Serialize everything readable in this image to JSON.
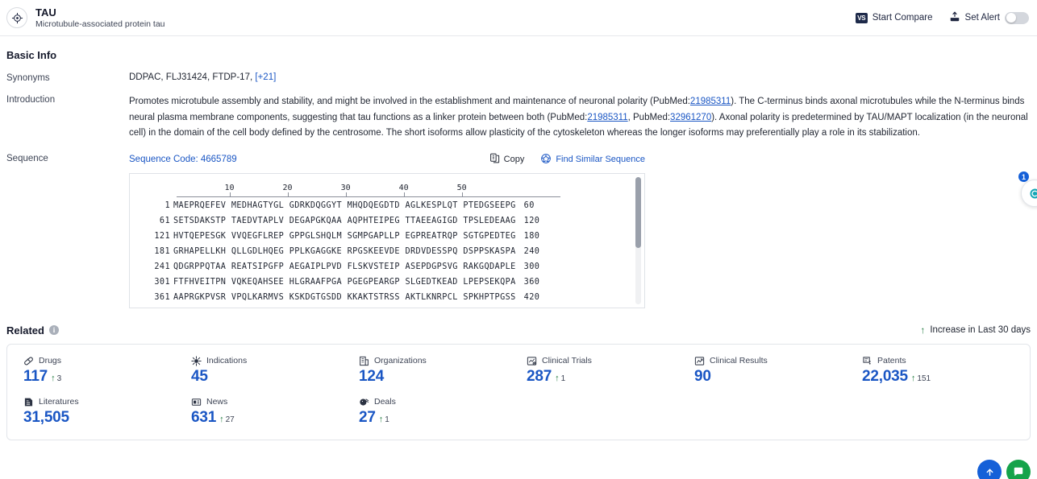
{
  "header": {
    "logo_icon": "target-crosshair-icon",
    "title": "TAU",
    "subtitle": "Microtubule-associated protein tau",
    "actions": {
      "start_compare": "Start Compare",
      "vs_badge": "VS",
      "set_alert": "Set Alert",
      "alert_toggle_state": "off"
    }
  },
  "basic_info": {
    "section_title": "Basic Info",
    "synonyms": {
      "label": "Synonyms",
      "value": "DDPAC, FLJ31424, FTDP-17,",
      "more_link": "[+21]"
    },
    "introduction": {
      "label": "Introduction",
      "p1": "Promotes microtubule assembly and stability, and might be involved in the establishment and maintenance of neuronal polarity (PubMed:",
      "ref1": "21985311",
      "p2": "). The C-terminus binds axonal microtubules while the N-terminus binds neural plasma membrane components, suggesting that tau functions as a linker protein between both (PubMed:",
      "ref2": "21985311",
      "p3": ", PubMed:",
      "ref3": "32961270",
      "p4": "). Axonal polarity is predetermined by TAU/MAPT localization (in the neuronal cell) in the domain of the cell body defined by the centrosome. The short isoforms allow plasticity of the cytoskeleton whereas the longer isoforms may preferentially play a role in its stabilization."
    },
    "sequence": {
      "label": "Sequence",
      "code_label": "Sequence Code: 4665789",
      "copy_label": "Copy",
      "find_similar_label": "Find Similar Sequence",
      "ruler_ticks": [
        10,
        20,
        30,
        40,
        50
      ],
      "rows": [
        {
          "start": "1",
          "chunks": "MAEPRQEFEV MEDHAGTYGL GDRKDQGGYT MHQDQEGDTD AGLKESPLQT PTEDGSEEPG",
          "end": "60"
        },
        {
          "start": "61",
          "chunks": "SETSDAKSTP TAEDVTAPLV DEGAPGKQAA AQPHTEIPEG TTAEEAGIGD TPSLEDEAAG",
          "end": "120"
        },
        {
          "start": "121",
          "chunks": "HVTQEPESGK VVQEGFLREP GPPGLSHQLM SGMPGAPLLP EGPREATRQP SGTGPEDTEG",
          "end": "180"
        },
        {
          "start": "181",
          "chunks": "GRHAPELLKH QLLGDLHQEG PPLKGAGGKE RPGSKEEVDE DRDVDESSPQ DSPPSKASPA",
          "end": "240"
        },
        {
          "start": "241",
          "chunks": "QDGRPPQTAA REATSIPGFP AEGAIPLPVD FLSKVSTEIP ASEPDGPSVG RAKGQDAPLE",
          "end": "300"
        },
        {
          "start": "301",
          "chunks": "FTFHVEITPN VQKEQAHSEE HLGRAAFPGA PGEGPEARGP SLGEDTKEAD LPEPSEKQPA",
          "end": "360"
        },
        {
          "start": "361",
          "chunks": "AAPRGKPVSR VPQLKARMVS KSKDGTGSDD KKAKTSTRSS AKTLKNRPCL SPKHPTPGSS",
          "end": "420"
        }
      ]
    }
  },
  "related": {
    "title": "Related",
    "info_icon_label": "i",
    "legend": "Increase in Last 30 days",
    "legend_arrow": "↑",
    "stats": [
      {
        "icon": "pill-icon",
        "label": "Drugs",
        "value": "117",
        "delta": "3"
      },
      {
        "icon": "virus-icon",
        "label": "Indications",
        "value": "45",
        "delta": ""
      },
      {
        "icon": "building-icon",
        "label": "Organizations",
        "value": "124",
        "delta": ""
      },
      {
        "icon": "clinical-trial-icon",
        "label": "Clinical Trials",
        "value": "287",
        "delta": "1"
      },
      {
        "icon": "clinical-result-icon",
        "label": "Clinical Results",
        "value": "90",
        "delta": ""
      },
      {
        "icon": "patent-icon",
        "label": "Patents",
        "value": "22,035",
        "delta": "151"
      },
      {
        "icon": "literature-icon",
        "label": "Literatures",
        "value": "31,505",
        "delta": ""
      },
      {
        "icon": "news-icon",
        "label": "News",
        "value": "631",
        "delta": "27"
      },
      {
        "icon": "deal-icon",
        "label": "Deals",
        "value": "27",
        "delta": "1"
      }
    ]
  },
  "floating": {
    "side_badge_count": "1",
    "side_icon": "chat-support-icon",
    "bottom_primary_icon": "scroll-top-icon",
    "bottom_secondary_icon": "chat-icon",
    "colors": {
      "accent_blue": "#1a56c4",
      "up_green": "#1f7a3d"
    }
  }
}
